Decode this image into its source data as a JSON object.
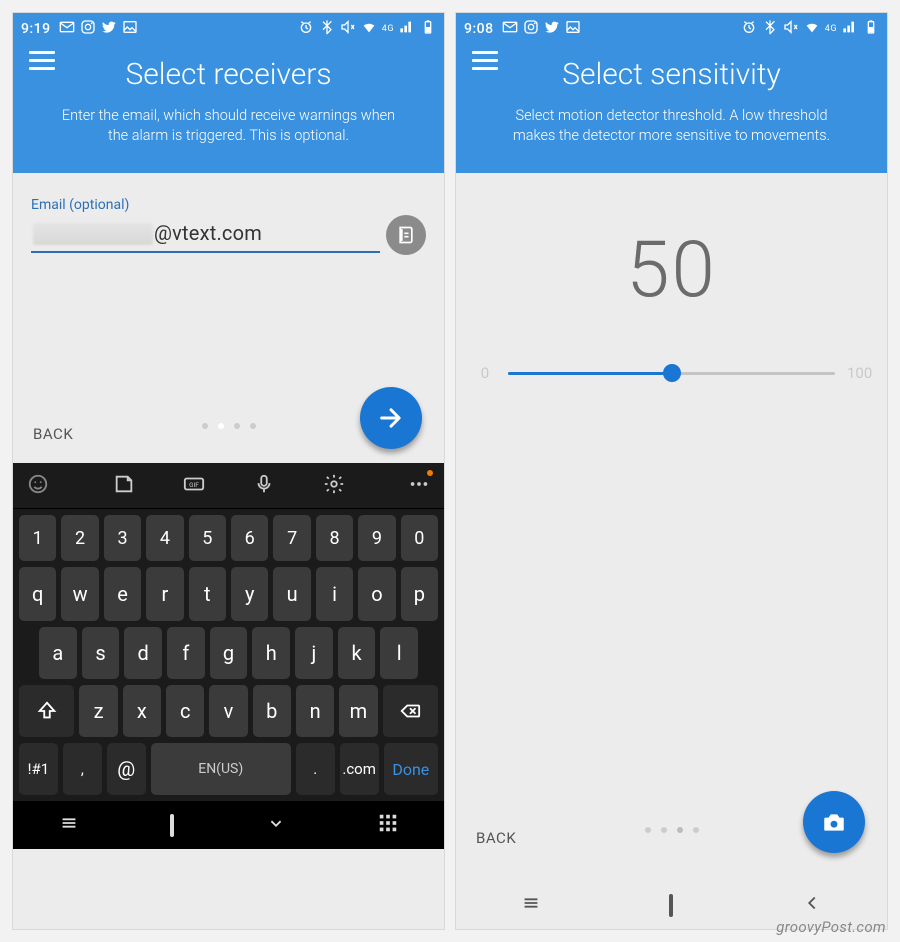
{
  "left": {
    "status_time": "9:19",
    "title": "Select receivers",
    "subtitle": "Enter the email, which should receive warnings when the alarm is triggered. This is optional.",
    "field_label": "Email (optional)",
    "email_suffix": "@vtext.com",
    "back_label": "BACK",
    "keyboard": {
      "row_num": [
        "1",
        "2",
        "3",
        "4",
        "5",
        "6",
        "7",
        "8",
        "9",
        "0"
      ],
      "row_q": [
        "q",
        "w",
        "e",
        "r",
        "t",
        "y",
        "u",
        "i",
        "o",
        "p"
      ],
      "row_a": [
        "a",
        "s",
        "d",
        "f",
        "g",
        "h",
        "j",
        "k",
        "l"
      ],
      "row_z": [
        "z",
        "x",
        "c",
        "v",
        "b",
        "n",
        "m"
      ],
      "sym": "!#1",
      "comma": ",",
      "at": "@",
      "space": "EN(US)",
      "period": ".",
      "com": ".com",
      "done": "Done"
    }
  },
  "right": {
    "status_time": "9:08",
    "title": "Select sensitivity",
    "subtitle": "Select motion detector threshold. A low threshold makes the detector more sensitive to movements.",
    "value": "50",
    "min_label": "0",
    "max_label": "100",
    "slider_percent": 50,
    "back_label": "BACK"
  },
  "watermark": "groovyPost.com"
}
